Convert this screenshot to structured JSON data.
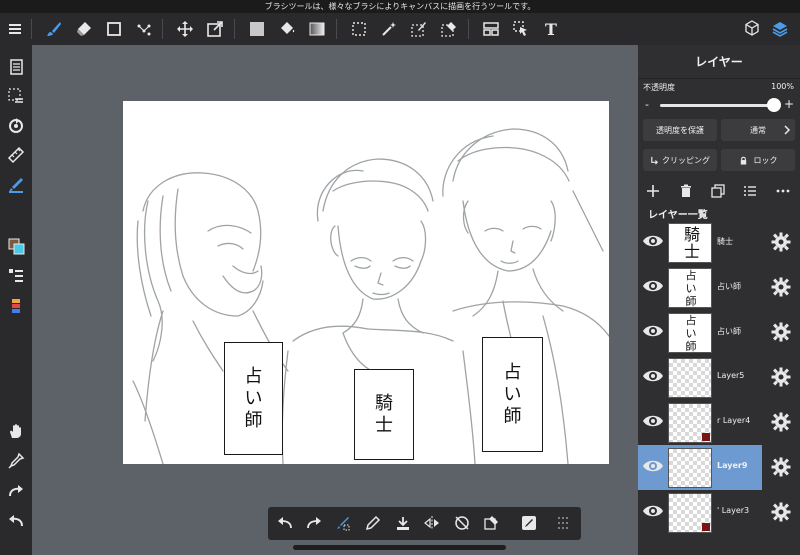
{
  "status_bar": {
    "text": "ブラシツールは、様々なブラシによりキャンバスに描画を行うツールです。"
  },
  "toolbar": {
    "icons": [
      "menu-icon",
      "brush-icon",
      "eraser-icon",
      "rectangle-icon",
      "select-dots-icon",
      "move-icon",
      "transform-icon",
      "fill-color-icon",
      "bucket-icon",
      "gradient-icon",
      "selection-icon",
      "magic-wand-icon",
      "select-pen-icon",
      "select-eraser-icon",
      "panel-layout-icon",
      "pointer-icon",
      "text-icon",
      "materials-icon",
      "layers-icon"
    ],
    "text_tool_label": "T"
  },
  "left_toolbar": {
    "icons": [
      "pages-icon",
      "selection-list-icon",
      "rotate-icon",
      "ruler-icon",
      "brush-color-icon",
      "color-swatch-icon",
      "layer-order-icon",
      "palette-icon",
      "hand-icon",
      "eyedropper-icon",
      "redo-icon",
      "undo-icon"
    ]
  },
  "canvas": {
    "bubbles": [
      {
        "text": [
          "占",
          "い",
          "師"
        ]
      },
      {
        "text": [
          "騎",
          "士"
        ]
      },
      {
        "text": [
          "占",
          "い",
          "師"
        ]
      }
    ]
  },
  "bottom_toolbar": {
    "icons": [
      "undo-icon",
      "redo-icon",
      "transform-brush-icon",
      "pen-icon",
      "save-icon",
      "flip-icon",
      "rotate-off-icon",
      "clear-icon",
      "edit-icon",
      "grid-icon"
    ]
  },
  "layer_panel": {
    "title": "レイヤー",
    "opacity_label": "不透明度",
    "opacity_value": "100%",
    "opacity_level": 1.0,
    "slider_minus": "-",
    "slider_plus": "+",
    "protect_button": "透明度を保護",
    "blend_mode": "通常",
    "clipping_button": "クリッピング",
    "lock_button": "ロック",
    "list_header": "レイヤー一覧",
    "thumb_text": {
      "knight": "騎士",
      "fortune": "占い師"
    },
    "layers": [
      {
        "name": "騎士",
        "selected": false
      },
      {
        "name": "占い師",
        "selected": false
      },
      {
        "name": "占い師",
        "selected": false
      },
      {
        "name": "Layer5",
        "selected": false
      },
      {
        "name": "r Layer4",
        "selected": false
      },
      {
        "name": "Layer9",
        "selected": true
      },
      {
        "name": "' Layer3",
        "selected": false
      }
    ]
  },
  "colors": {
    "accent": "#6d9ad1",
    "brush_blue": "#4a9be8",
    "toolbar_bg": "#2a2a2c",
    "workspace_bg": "#5d6268"
  }
}
